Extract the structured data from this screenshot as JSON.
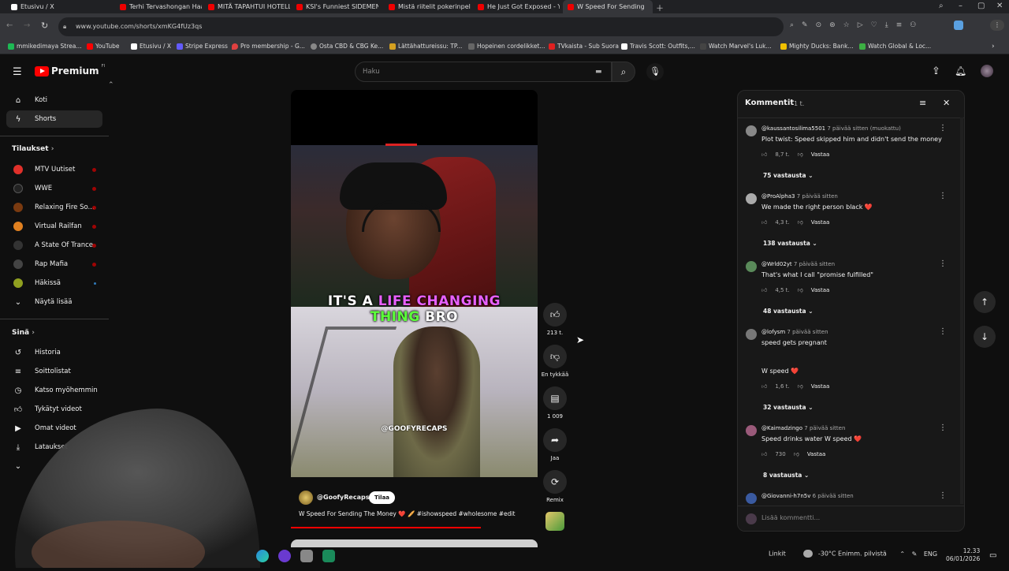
{
  "tabs": [
    {
      "label": "Etusivu / X",
      "active": false
    },
    {
      "label": "Terhi Tervashongan Haasta",
      "active": false
    },
    {
      "label": "MITÄ TAPAHTUI HOTELLII",
      "active": false
    },
    {
      "label": "KSI's Funniest SIDEMEN M",
      "active": false
    },
    {
      "label": "Mistä riitelit pokerinpelass",
      "active": false
    },
    {
      "label": "He Just Got Exposed - You",
      "active": false
    },
    {
      "label": "W Speed For Sending",
      "active": true
    }
  ],
  "address": {
    "url": "www.youtube.com/shorts/xmKG4fUz3qs"
  },
  "bookmarks": [
    {
      "label": "mmikedimaya Strea...",
      "color": "#1db954"
    },
    {
      "label": "YouTube",
      "color": "#ff0000"
    },
    {
      "label": "Etusivu / X",
      "color": "#ffffff"
    },
    {
      "label": "Stripe Express",
      "color": "#635bff"
    },
    {
      "label": "Pro membership - G...",
      "color": "#e04040"
    },
    {
      "label": "Osta CBD & CBG Ke...",
      "color": "#888888"
    },
    {
      "label": "Lättähattureissu: TP...",
      "color": "#d4a020"
    },
    {
      "label": "Hopeinen cordelikket...",
      "color": "#666666"
    },
    {
      "label": "TVkaista - Sub Suora",
      "color": "#e02020"
    },
    {
      "label": "Travis Scott: Outfits,...",
      "color": "#ffffff"
    },
    {
      "label": "Watch Marvel's Luk...",
      "color": "#444444"
    },
    {
      "label": "Mighty Ducks: Bank...",
      "color": "#f0c000"
    },
    {
      "label": "Watch Global & Loc...",
      "color": "#3cb043"
    }
  ],
  "header": {
    "brand": "Premium",
    "region": "FI",
    "search_placeholder": "Haku"
  },
  "sidebar": {
    "main": [
      {
        "label": "Koti",
        "icon": "home-icon",
        "active": false
      },
      {
        "label": "Shorts",
        "icon": "shorts-icon",
        "active": true
      }
    ],
    "subs_title": "Tilaukset",
    "subscriptions": [
      {
        "label": "MTV Uutiset",
        "color": "#e0302a",
        "live": true
      },
      {
        "label": "WWE",
        "color": "#222222",
        "live": true
      },
      {
        "label": "Relaxing Fire So...",
        "color": "#7a3a10",
        "live": true
      },
      {
        "label": "Virtual Railfan",
        "color": "#e08020",
        "live": true
      },
      {
        "label": "A State Of Trance",
        "color": "#333333",
        "live": true
      },
      {
        "label": "Rap Mafia",
        "color": "#444444",
        "live": true
      },
      {
        "label": "Häkissä",
        "color": "#90a020",
        "live": false
      }
    ],
    "show_more": "Näytä lisää",
    "you_title": "Sinä",
    "you_items": [
      {
        "label": "Historia",
        "icon": "history-icon"
      },
      {
        "label": "Soittolistat",
        "icon": "playlist-icon"
      },
      {
        "label": "Katso myöhemmin",
        "icon": "clock-icon"
      },
      {
        "label": "Tykätyt videot",
        "icon": "thumbs-up-icon"
      },
      {
        "label": "Omat videot",
        "icon": "video-icon"
      },
      {
        "label": "Lataukset",
        "icon": "download-icon"
      }
    ]
  },
  "video": {
    "caption_white": "IT'S A",
    "caption_pink": "LIFE CHANGING",
    "caption_green": "THING",
    "caption_tail": "BRO",
    "watermark": "@GOOFYRECAPS",
    "channel": "@GoofyRecaps",
    "subscribe": "Tilaa",
    "title": "W Speed For Sending The Money ❤️ 🥖 #ishowspeed #wholesome #edit",
    "progress": 0.77
  },
  "actions": [
    {
      "label": "213 t.",
      "icon": "thumbs-up-icon"
    },
    {
      "label": "En tykkää",
      "icon": "thumbs-down-icon"
    },
    {
      "label": "1 009",
      "icon": "comment-icon"
    },
    {
      "label": "Jaa",
      "icon": "share-icon"
    },
    {
      "label": "Remix",
      "icon": "remix-icon"
    }
  ],
  "comments_panel": {
    "title": "Kommentit",
    "count": "1 t.",
    "add_placeholder": "Lisää kommentti...",
    "reply_label": "Vastaa",
    "items": [
      {
        "author": "@kaussantosilima5501",
        "time": "7 päivää sitten (muokattu)",
        "text": "Plot twist: Speed skipped him and didn't send the money",
        "likes": "8,7 t.",
        "replies": "75 vastausta",
        "color": "#888888"
      },
      {
        "author": "@ProAlpha3",
        "time": "7 päivää sitten",
        "text": "We made the right person black ❤️",
        "likes": "4,3 t.",
        "replies": "138 vastausta",
        "color": "#aaaaaa"
      },
      {
        "author": "@Wrld02yt",
        "time": "7 päivää sitten",
        "text": "That's what I call \"promise fulfilled\"",
        "likes": "4,5 t.",
        "replies": "48 vastausta",
        "color": "#5a8a5a"
      },
      {
        "author": "@lofysm",
        "time": "7 päivää sitten",
        "text": "speed gets pregnant",
        "text2": "W speed ❤️",
        "likes": "1,6 t.",
        "replies": "32 vastausta",
        "color": "#777777"
      },
      {
        "author": "@Kaimadzingo",
        "time": "7 päivää sitten",
        "text": "Speed drinks water W speed ❤️",
        "likes": "730",
        "replies": "8 vastausta",
        "color": "#9a5a7a"
      },
      {
        "author": "@Giovanni-h7n5v",
        "time": "6 päivää sitten",
        "text": "",
        "likes": "",
        "replies": "",
        "color": "#3a5aa0"
      }
    ]
  },
  "taskbar": {
    "links": "Linkit",
    "weather": "-30°C",
    "weather_desc": "Enimm. pilvistä",
    "lang": "ENG",
    "time": "12.33",
    "date": "06/01/2026"
  }
}
